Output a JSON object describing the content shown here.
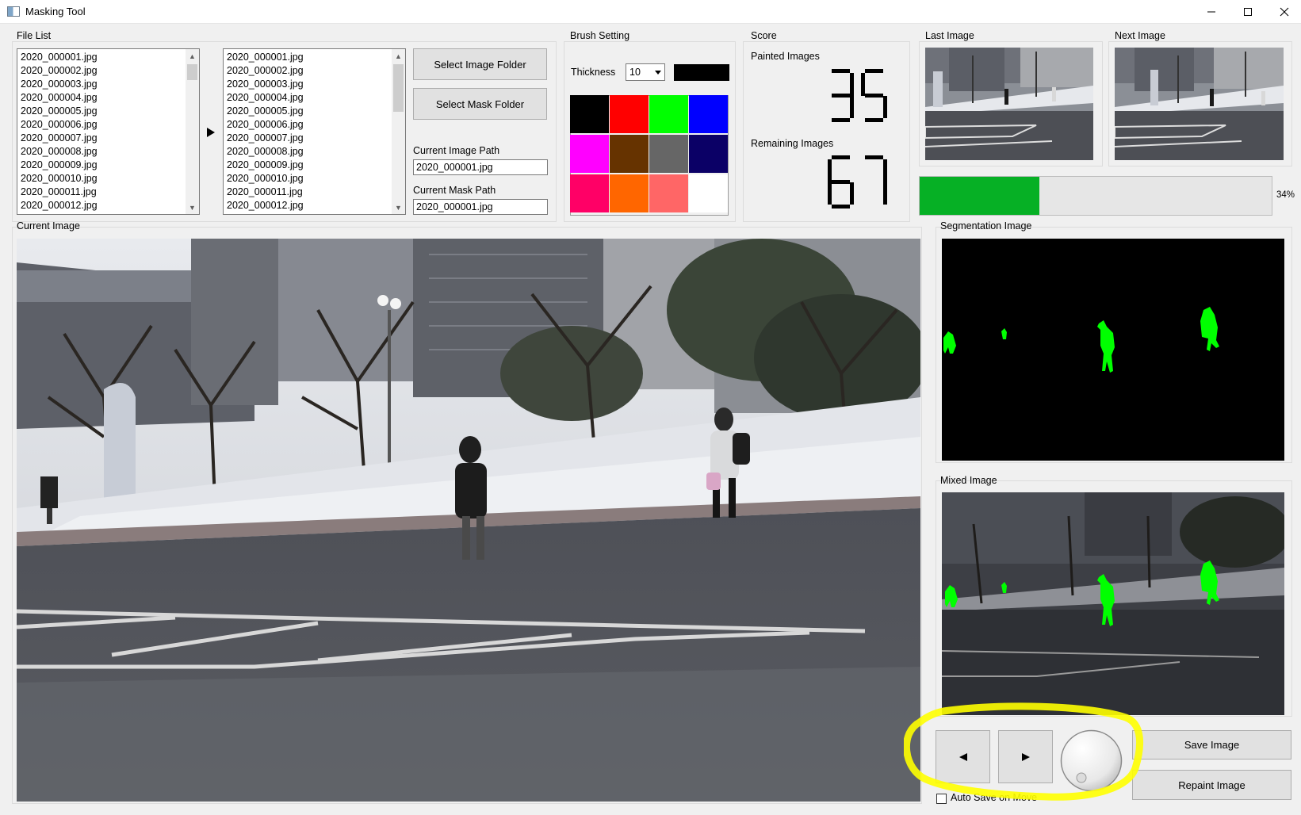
{
  "window": {
    "title": "Masking Tool",
    "controls": {
      "minimize": "minimize-icon",
      "maximize": "maximize-icon",
      "close": "close-icon"
    }
  },
  "file_list": {
    "label": "File List",
    "image_files": [
      "2020_000001.jpg",
      "2020_000002.jpg",
      "2020_000003.jpg",
      "2020_000004.jpg",
      "2020_000005.jpg",
      "2020_000006.jpg",
      "2020_000007.jpg",
      "2020_000008.jpg",
      "2020_000009.jpg",
      "2020_000010.jpg",
      "2020_000011.jpg",
      "2020_000012.jpg"
    ],
    "mask_files": [
      "2020_000001.jpg",
      "2020_000002.jpg",
      "2020_000003.jpg",
      "2020_000004.jpg",
      "2020_000005.jpg",
      "2020_000006.jpg",
      "2020_000007.jpg",
      "2020_000008.jpg",
      "2020_000009.jpg",
      "2020_000010.jpg",
      "2020_000011.jpg",
      "2020_000012.jpg"
    ],
    "arrow_icon": "play-arrow-icon",
    "select_image_folder": "Select Image Folder",
    "select_mask_folder": "Select Mask Folder",
    "current_image_path_label": "Current Image Path",
    "current_image_path": "2020_000001.jpg",
    "current_mask_path_label": "Current Mask Path",
    "current_mask_path": "2020_000001.jpg"
  },
  "brush": {
    "label": "Brush Setting",
    "thickness_label": "Thickness",
    "thickness_value": "10",
    "current_color": "#000000",
    "palette": [
      "#000000",
      "#ff0000",
      "#00ff00",
      "#0000ff",
      "#ff00ff",
      "#663300",
      "#666666",
      "#0b0066",
      "#ff0066",
      "#ff6600",
      "#ff6666",
      "#ffffff"
    ]
  },
  "score": {
    "label": "Score",
    "painted_label": "Painted Images",
    "painted_value": "35",
    "remaining_label": "Remaining Images",
    "remaining_value": "67"
  },
  "last_image": {
    "label": "Last Image"
  },
  "next_image": {
    "label": "Next Image"
  },
  "progress": {
    "fraction": 0.34,
    "text": "34%",
    "color": "#06b025"
  },
  "current_image": {
    "label": "Current Image"
  },
  "segmentation_image": {
    "label": "Segmentation Image",
    "mask_color": "#00ff00"
  },
  "mixed_image": {
    "label": "Mixed Image"
  },
  "navigation": {
    "prev_icon": "triangle-left-icon",
    "next_icon": "triangle-right-icon",
    "dial_icon": "dial-knob-icon",
    "save_image": "Save Image",
    "repaint_image": "Repaint Image",
    "auto_save_label": "Auto Save on Move",
    "auto_save_checked": false,
    "highlight_color": "#ffff00"
  }
}
